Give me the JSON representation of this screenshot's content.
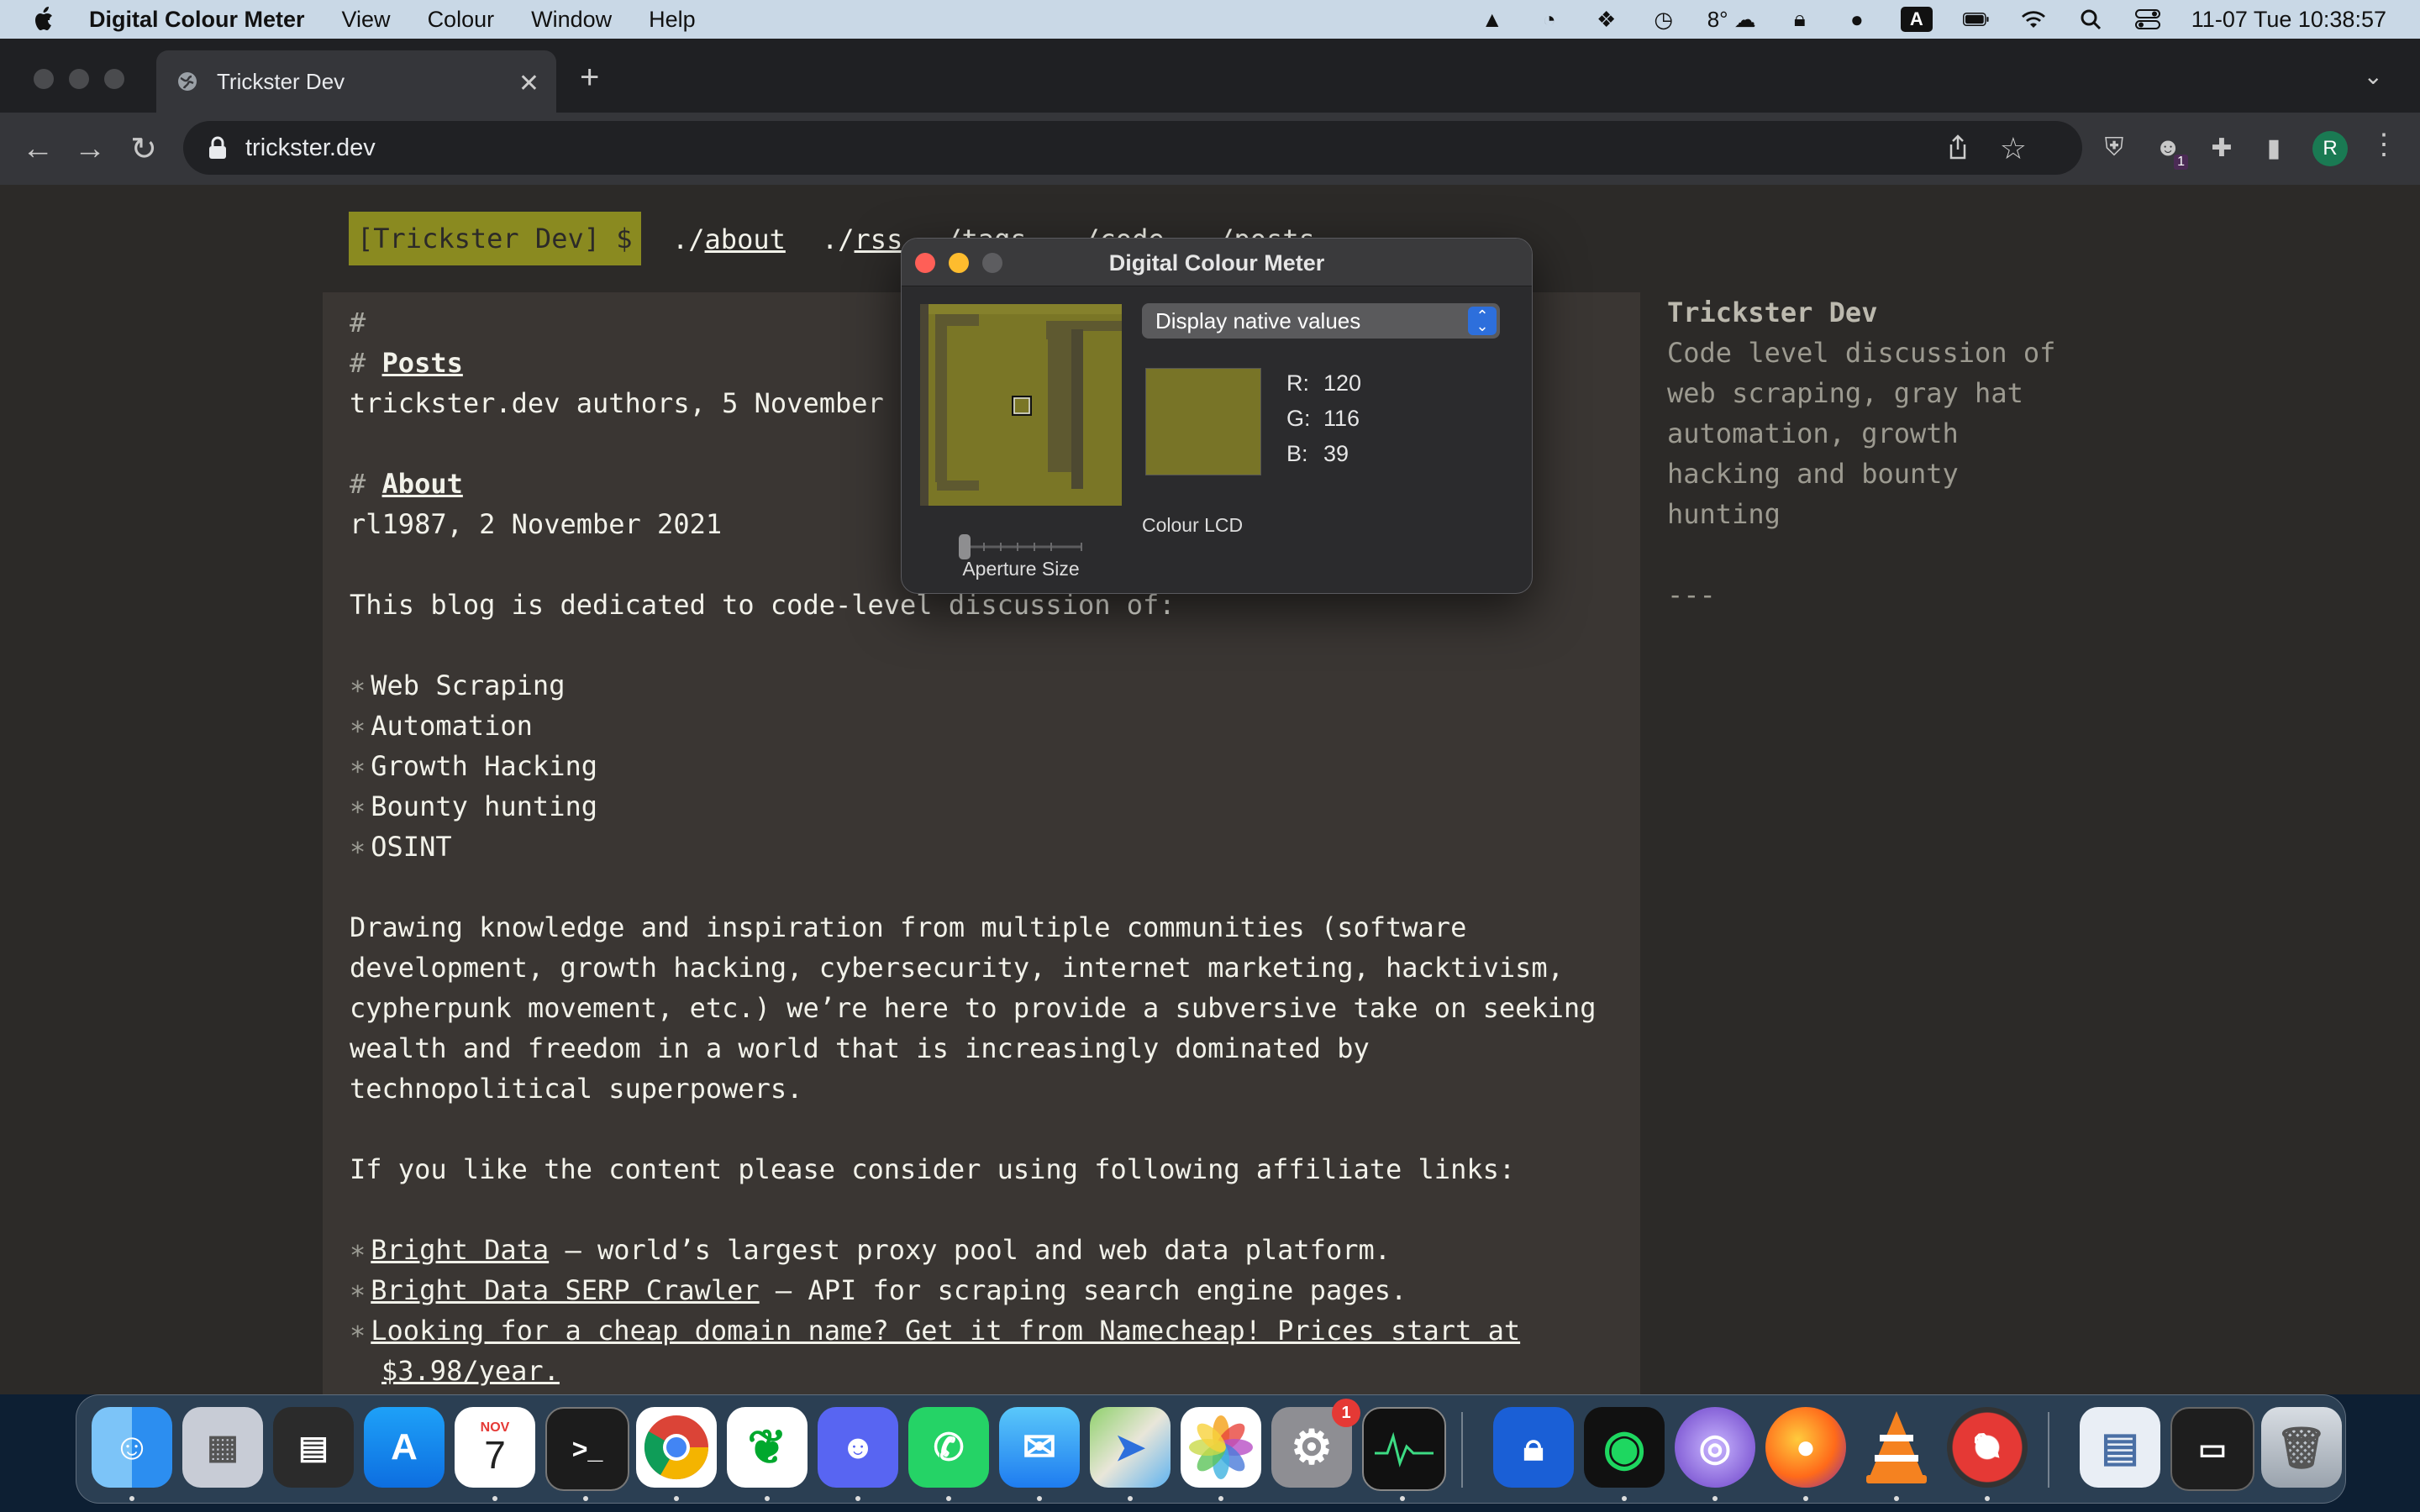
{
  "menubar": {
    "app_name": "Digital Colour Meter",
    "menus": [
      "View",
      "Colour",
      "Window",
      "Help"
    ],
    "temperature": "8°",
    "input_source": "A",
    "clock": "11-07 Tue  10:38:57"
  },
  "browser": {
    "tab_title": "Trickster Dev",
    "url": "trickster.dev",
    "extension_badge": "1",
    "profile_initial": "R"
  },
  "page": {
    "logo": "[Trickster Dev] $",
    "nav": [
      {
        "prefix": "./",
        "label": "about"
      },
      {
        "prefix": "./",
        "label": "rss"
      },
      {
        "prefix": "./",
        "label": "tags"
      },
      {
        "prefix": "./",
        "label": "code"
      },
      {
        "prefix": "./",
        "label": "posts"
      }
    ],
    "hash": "#",
    "posts_heading": "Posts",
    "posts_meta": "trickster.dev authors, 5 November",
    "about_heading": "About",
    "about_meta": "rl1987, 2 November 2021",
    "intro": "This blog is dedicated to code-level discussion of:",
    "topics": [
      "Web Scraping",
      "Automation",
      "Growth Hacking",
      "Bounty hunting",
      "OSINT"
    ],
    "paragraph": [
      "Drawing knowledge and inspiration from multiple communities (software",
      "development, growth hacking, cybersecurity, internet marketing, hacktivism,",
      "cypherpunk movement, etc.) we’re here to provide a subversive take on seeking",
      "wealth and freedom in a world that is increasingly dominated by",
      "technopolitical superpowers."
    ],
    "affiliate_intro": "If you like the content please consider using following affiliate links:",
    "affiliates": [
      {
        "link": "Bright Data",
        "desc": " – world’s largest proxy pool and web data platform."
      },
      {
        "link": "Bright Data SERP Crawler",
        "desc": " – API for scraping search engine pages."
      },
      {
        "link": "Looking for a cheap domain name? Get it from Namecheap! Prices start at",
        "desc": ""
      }
    ],
    "affiliate_cont": "$3.98/year."
  },
  "sidebar": {
    "title": "Trickster Dev",
    "lines": [
      "Code level discussion of",
      "web scraping, gray hat",
      "automation, growth",
      "hacking and bounty",
      "hunting"
    ],
    "rule": "---"
  },
  "colour_meter": {
    "window_title": "Digital Colour Meter",
    "mode": "Display native values",
    "r_label": "R:",
    "r": "120",
    "g_label": "G:",
    "g": "116",
    "b_label": "B:",
    "b": "39",
    "sample_color": "#787427",
    "display_name": "Colour LCD",
    "aperture_label": "Aperture Size",
    "aperture_level": 0
  },
  "dock": {
    "calendar_month": "NOV",
    "calendar_day": "7",
    "settings_badge": "1",
    "apps": [
      "Finder",
      "Launchpad",
      "Mission Control",
      "App Store",
      "Calendar",
      "Terminal",
      "Chrome",
      "Evernote",
      "Discord",
      "WhatsApp",
      "Mail",
      "Maps",
      "Photos",
      "System Settings",
      "Activity Monitor",
      "1Password",
      "Spotify",
      "Tor Browser",
      "Firefox",
      "VLC",
      "Instruments",
      "Documents",
      "Screenshot",
      "Trash"
    ]
  }
}
